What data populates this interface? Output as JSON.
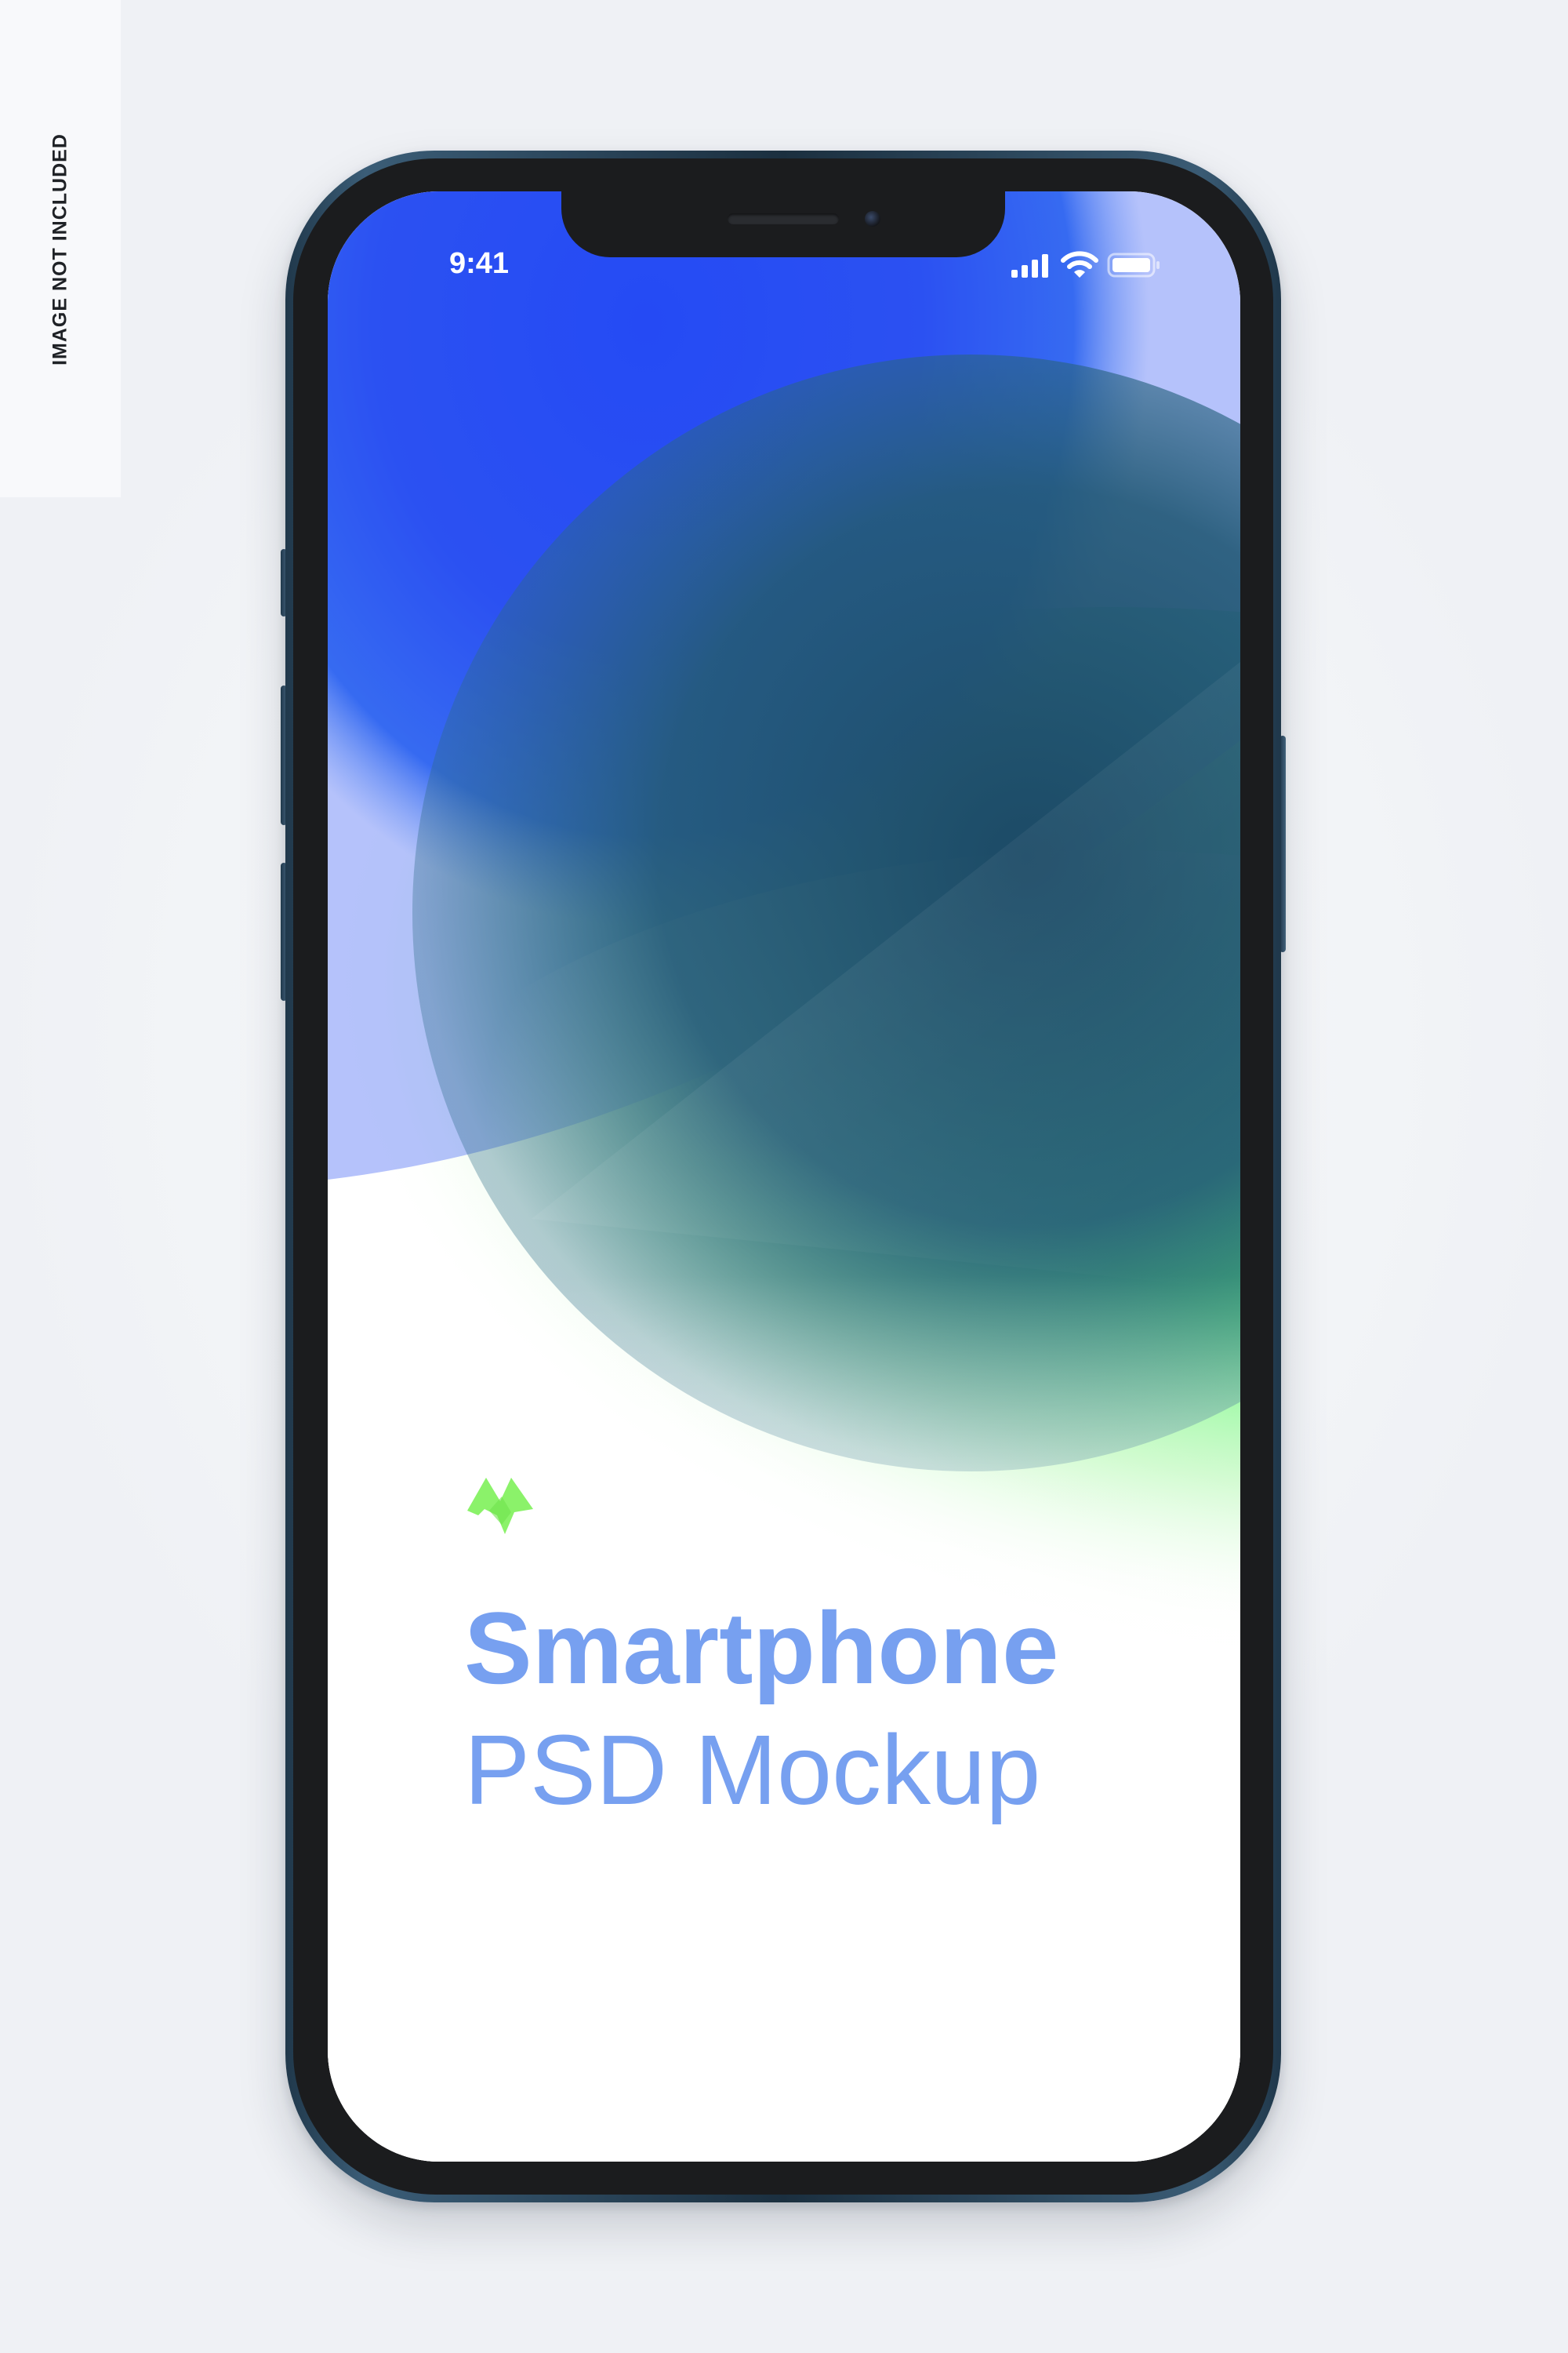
{
  "side_label": "IMAGE NOT INCLUDED",
  "status_bar": {
    "time": "9:41",
    "icons": [
      "cellular-signal-icon",
      "wifi-icon",
      "battery-icon"
    ]
  },
  "screen": {
    "title": "Smartphone",
    "subtitle": "PSD Mockup",
    "logo_icon": "brand-logo-icon"
  },
  "colors": {
    "background": "#eff1f5",
    "frame": "#2c4a62",
    "text_accent": "#77a0f0",
    "wallpaper_blue": "#2350f6",
    "wallpaper_green": "#45f060",
    "logo_green": "#8bf26a"
  }
}
